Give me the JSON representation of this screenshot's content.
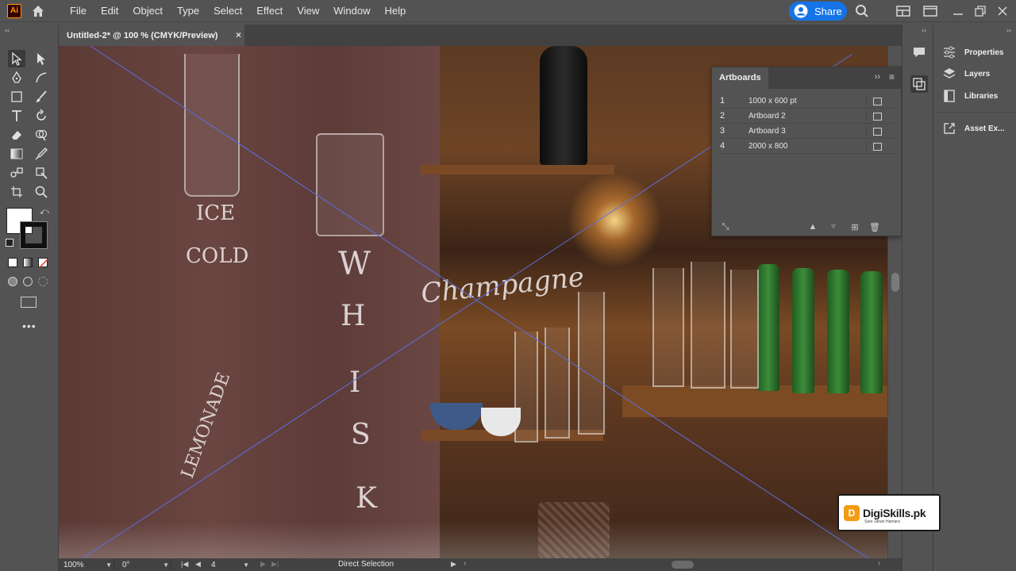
{
  "app": {
    "logo_text": "Ai"
  },
  "menu": [
    "File",
    "Edit",
    "Object",
    "Type",
    "Select",
    "Effect",
    "View",
    "Window",
    "Help"
  ],
  "share_label": "Share",
  "document_tab": {
    "title": "Untitled-2* @ 100 % (CMYK/Preview)",
    "close_glyph": "×"
  },
  "artboards_panel": {
    "title": "Artboards",
    "rows": [
      {
        "num": "1",
        "name": "1000 x 600 pt"
      },
      {
        "num": "2",
        "name": "Artboard 2"
      },
      {
        "num": "3",
        "name": "Artboard 3"
      },
      {
        "num": "4",
        "name": "2000 x 800"
      }
    ]
  },
  "right_dock": {
    "items": [
      {
        "label": "Properties",
        "icon": "sliders-icon"
      },
      {
        "label": "Layers",
        "icon": "layers-icon"
      },
      {
        "label": "Libraries",
        "icon": "libraries-icon"
      },
      {
        "label": "Asset Ex...",
        "icon": "asset-export-icon"
      }
    ]
  },
  "status_bar": {
    "zoom": "100%",
    "rotation": "0°",
    "artboard_number": "4",
    "tool_name": "Direct Selection"
  },
  "canvas_text": {
    "ice": "ICE",
    "cold": "COLD",
    "champagne": "Champagne",
    "lemonade": "LEMONADE",
    "whisky": [
      "W",
      "H",
      "I",
      "S",
      "K"
    ]
  },
  "watermark": {
    "logo": "D",
    "text": "DigiSkills.pk",
    "tagline": "Sare Jahan Hamara"
  },
  "colors": {
    "ui_bg": "#535353",
    "accent": "#1473e6",
    "logo": "#ff9a00"
  }
}
